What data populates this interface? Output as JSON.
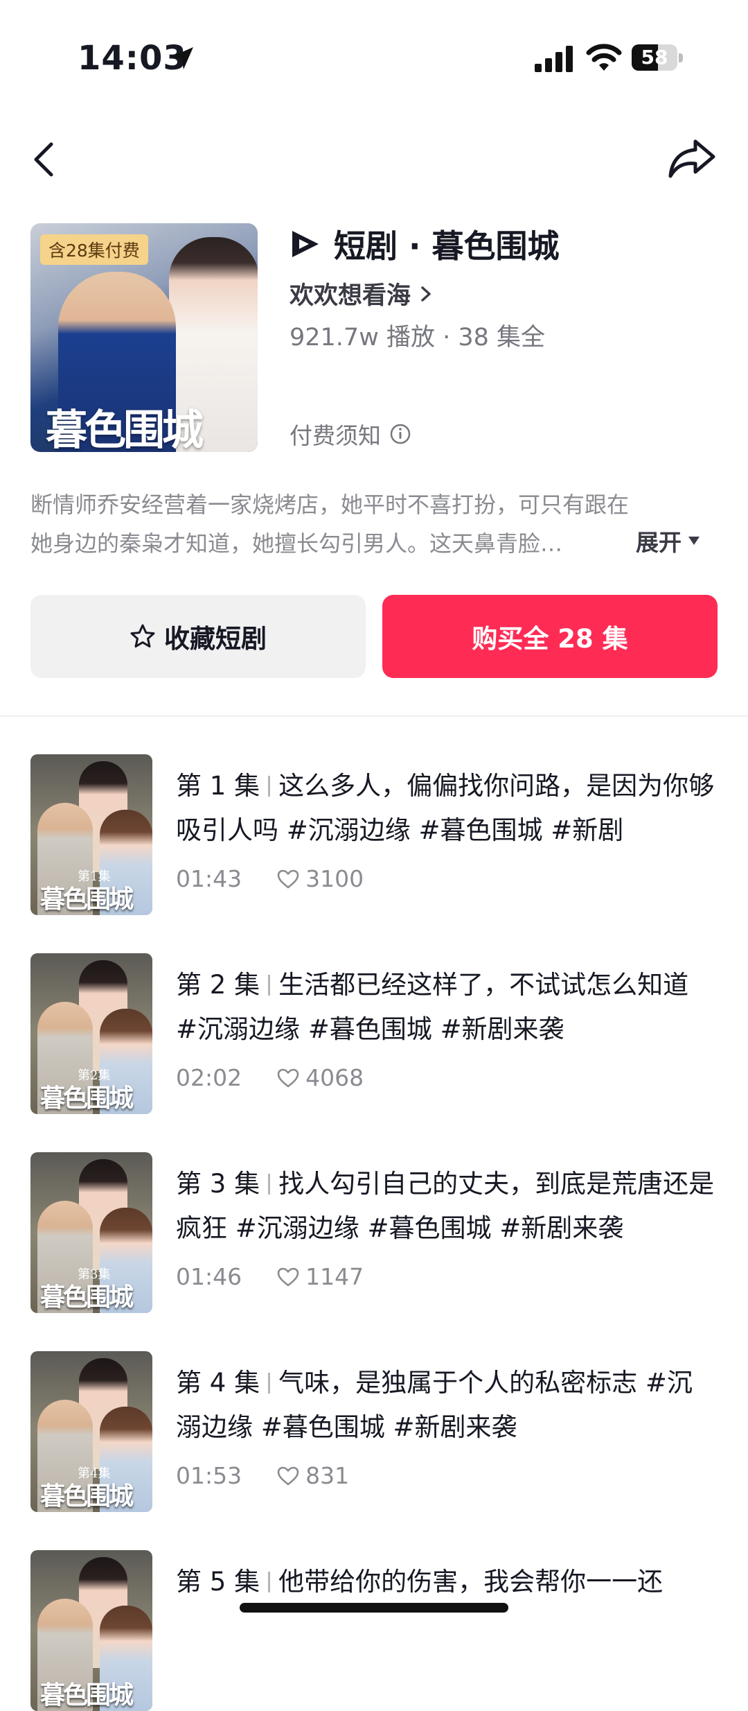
{
  "status_bar": {
    "time": "14:03",
    "battery": "58",
    "battery_fraction": 0.58
  },
  "header": {
    "cover_badge": "含28集付费",
    "cover_title": "暮色围城",
    "title": "短剧 · 暮色围城",
    "author": "欢欢想看海",
    "stats": "921.7w 播放 · 38 集全",
    "pay_notice": "付费须知"
  },
  "description": {
    "line1": "断情师乔安经营着一家烧烤店，她平时不喜打扮，可只有跟在",
    "line2": "她身边的秦枭才知道，她擅长勾引男人。这天鼻青脸…",
    "expand_label": "展开"
  },
  "actions": {
    "favorite_label": "收藏短剧",
    "buy_label": "购买全 28 集"
  },
  "colors": {
    "accent": "#fe2c55",
    "text": "#161823",
    "muted": "#8a8b91"
  },
  "episodes": [
    {
      "num": "第 1 集",
      "thumb_label": "第1集",
      "title": "这么多人，偏偏找你问路，是因为你够吸引人吗 #沉溺边缘 #暮色围城 #新剧",
      "duration": "01:43",
      "likes": "3100"
    },
    {
      "num": "第 2 集",
      "thumb_label": "第2集",
      "title": "生活都已经这样了，不试试怎么知道 #沉溺边缘 #暮色围城 #新剧来袭",
      "duration": "02:02",
      "likes": "4068"
    },
    {
      "num": "第 3 集",
      "thumb_label": "第3集",
      "title": "找人勾引自己的丈夫，到底是荒唐还是疯狂 #沉溺边缘 #暮色围城 #新剧来袭",
      "duration": "01:46",
      "likes": "1147"
    },
    {
      "num": "第 4 集",
      "thumb_label": "第4集",
      "title": "气味，是独属于个人的私密标志 #沉溺边缘 #暮色围城 #新剧来袭",
      "duration": "01:53",
      "likes": "831"
    },
    {
      "num": "第 5 集",
      "thumb_label": "",
      "title": "他带给你的伤害，我会帮你一一还",
      "duration": "",
      "likes": ""
    }
  ],
  "icons": [
    "location-arrow-icon",
    "cellular-signal-icon",
    "wifi-icon",
    "battery-icon",
    "back-icon",
    "share-icon",
    "drama-logo-icon",
    "chevron-right-icon",
    "info-icon",
    "triangle-down-icon",
    "star-icon",
    "heart-icon"
  ]
}
